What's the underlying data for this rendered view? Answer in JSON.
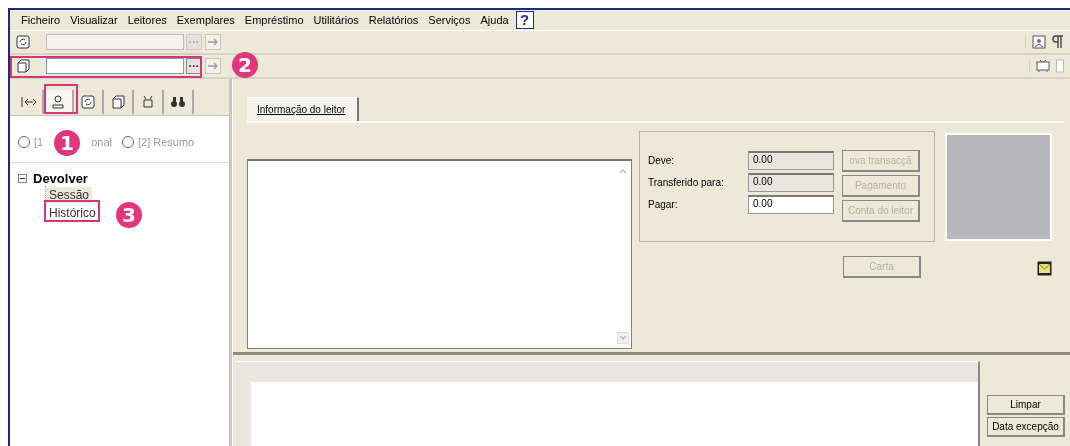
{
  "menu": {
    "items": [
      "Ficheiro",
      "Visualizar",
      "Leitores",
      "Exemplares",
      "Empréstimo",
      "Utilitários",
      "Relatórios",
      "Serviços",
      "Ajuda"
    ],
    "help": "?"
  },
  "toolbar_rows": [
    {
      "disabled": true,
      "ellipsis": "···"
    },
    {
      "disabled": false,
      "ellipsis": "···"
    }
  ],
  "sidebar": {
    "tabs": [
      {
        "selected": false
      },
      {
        "selected": true
      },
      {
        "selected": false
      },
      {
        "selected": false
      },
      {
        "selected": false
      },
      {
        "selected": false
      }
    ],
    "radios": [
      {
        "label_parts": [
          "[1",
          "onal"
        ],
        "selected": false
      },
      {
        "label_parts": [
          "[2] Resumo"
        ],
        "selected": false
      }
    ],
    "tree": [
      {
        "label": "Devolver",
        "expanded": true,
        "children": [
          {
            "label": "Sessão"
          },
          {
            "label": "Histórico"
          }
        ]
      }
    ]
  },
  "main": {
    "tabs": [
      {
        "label": "Informação do leitor",
        "selected": true
      }
    ],
    "fees": [
      {
        "label": "Deve:",
        "value": "0.00",
        "editable": false
      },
      {
        "label": "Transferido para:",
        "value": "0.00",
        "editable": false
      },
      {
        "label": "Pagar:",
        "value": "0.00",
        "editable": true
      }
    ],
    "fee_buttons": [
      {
        "label": "ova transacçã",
        "disabled": true
      },
      {
        "label": "Pagamento",
        "disabled": true
      },
      {
        "label": "Conta do leitor",
        "disabled": true
      }
    ],
    "letter_button": {
      "label": "Carta",
      "disabled": true
    },
    "side_buttons": [
      {
        "label": "Limpar",
        "disabled": false
      },
      {
        "label": "Data excepção",
        "disabled": false
      }
    ]
  },
  "callouts": [
    {
      "number": "1"
    },
    {
      "number": "2"
    },
    {
      "number": "3"
    }
  ]
}
